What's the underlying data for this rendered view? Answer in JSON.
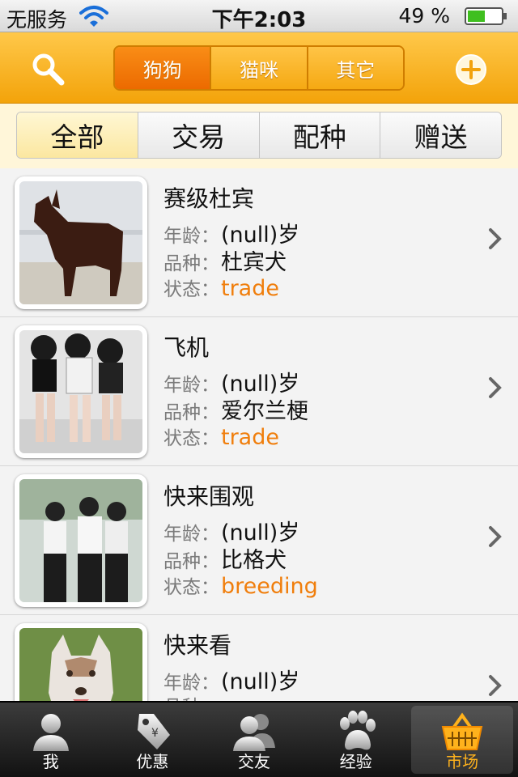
{
  "status_bar": {
    "carrier": "无服务",
    "time": "下午2:03",
    "battery": "49 %"
  },
  "nav": {
    "segments": [
      "狗狗",
      "猫咪",
      "其它"
    ],
    "active_segment": 0,
    "left_icon": "search-icon",
    "right_icon": "add-circle-icon"
  },
  "filter": {
    "options": [
      "全部",
      "交易",
      "配种",
      "赠送"
    ],
    "active": 0
  },
  "labels": {
    "age": "年龄：",
    "breed": "品种：",
    "status": "状态："
  },
  "items": [
    {
      "name": "赛级杜宾",
      "age": "(null)岁",
      "breed": "杜宾犬",
      "status": "trade"
    },
    {
      "name": "飞机",
      "age": "(null)岁",
      "breed": "爱尔兰梗",
      "status": "trade"
    },
    {
      "name": "快来围观",
      "age": "(null)岁",
      "breed": "比格犬",
      "status": "breeding"
    },
    {
      "name": "快来看",
      "age": "(null)岁",
      "breed": "",
      "status": ""
    }
  ],
  "tabbar": {
    "tabs": [
      {
        "label": "我",
        "icon": "person-icon"
      },
      {
        "label": "优惠",
        "icon": "price-tag-icon"
      },
      {
        "label": "交友",
        "icon": "friends-icon"
      },
      {
        "label": "经验",
        "icon": "paw-icon"
      },
      {
        "label": "市场",
        "icon": "basket-icon"
      }
    ],
    "active": 4
  },
  "colors": {
    "accent_orange": "#f07e0c",
    "nav_yellow": "#f8b623",
    "active_tab": "#ffb21c"
  }
}
